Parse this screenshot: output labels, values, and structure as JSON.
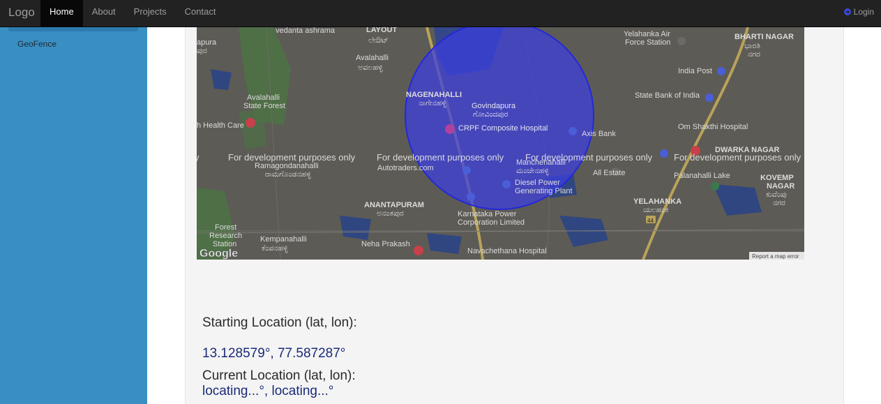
{
  "navbar": {
    "brand": "Logo",
    "items": [
      {
        "label": "Home",
        "active": true
      },
      {
        "label": "About"
      },
      {
        "label": "Projects"
      },
      {
        "label": "Contact"
      }
    ],
    "login_label": "Login"
  },
  "sidebar": {
    "items": [
      {
        "label": "GeoFence"
      }
    ]
  },
  "map": {
    "watermark": "For development purposes only",
    "report_label": "Report a map error",
    "google_logo": "Google",
    "places": [
      {
        "name": "vedanta ashrama"
      },
      {
        "name": "LAYOUT"
      },
      {
        "name": "ಲೇಔಟ್"
      },
      {
        "name": "Avalahalli"
      },
      {
        "name": "ಅವಲಹಳ್ಳಿ"
      },
      {
        "name": "Avalahalli"
      },
      {
        "name": "State Forest"
      },
      {
        "name": "h Health Care"
      },
      {
        "name": "Ramagondanahalli"
      },
      {
        "name": "ರಾಮಗೊಂಡನಹಳ್ಳಿ"
      },
      {
        "name": "Forest"
      },
      {
        "name": "Research"
      },
      {
        "name": "Station"
      },
      {
        "name": "Kempanahalli"
      },
      {
        "name": "ಕೆಂಪನಹಳ್ಳಿ"
      },
      {
        "name": "NAGENAHALLI"
      },
      {
        "name": "ನಾಗೇನಹಳ್ಳಿ"
      },
      {
        "name": "Govindapura"
      },
      {
        "name": "ಗೋವಿಂದಪುರ"
      },
      {
        "name": "CRPF Composite Hospital"
      },
      {
        "name": "Axis Bank"
      },
      {
        "name": "Autotraders.com"
      },
      {
        "name": "Diesel Power"
      },
      {
        "name": "Generating Plant"
      },
      {
        "name": "Manchenahalli"
      },
      {
        "name": "ಮಂಚೇನಹಳ್ಳಿ"
      },
      {
        "name": "ANANTAPURAM"
      },
      {
        "name": "ಅನಂತಪುರ"
      },
      {
        "name": "Karnataka Power"
      },
      {
        "name": "Corporation Limited"
      },
      {
        "name": "Neha Prakash"
      },
      {
        "name": "Navachethana Hospital"
      },
      {
        "name": "Yelahanka Air"
      },
      {
        "name": "Force Station"
      },
      {
        "name": "India Post"
      },
      {
        "name": "State Bank of India"
      },
      {
        "name": "Om Shakthi Hospital"
      },
      {
        "name": "BHARTI NAGAR"
      },
      {
        "name": "ಭಾರತಿ"
      },
      {
        "name": "ನಗರ"
      },
      {
        "name": "DWARKA NAGAR"
      },
      {
        "name": "Palanahalli Lake"
      },
      {
        "name": "KOVEMP"
      },
      {
        "name": "NAGAR"
      },
      {
        "name": "ಕುವೆಂಪು"
      },
      {
        "name": "ನಗರ"
      },
      {
        "name": "YELAHANKA"
      },
      {
        "name": "ಯಲಹಂಕ"
      },
      {
        "name": "44"
      },
      {
        "name": "All Estate"
      },
      {
        "name": "apura"
      },
      {
        "name": "ಪುರ"
      }
    ],
    "colors": {
      "circle": "#3b3fe0",
      "base": "#5d5b55"
    }
  },
  "location": {
    "start_label": "Starting Location (lat, lon):",
    "start_value": "13.128579°, 77.587287°",
    "current_label": "Current Location (lat, lon):",
    "current_value": "locating...°, locating...°"
  },
  "colors": {
    "sidebar": "#3a8fc2",
    "navbar": "#222222",
    "value_text": "#1a2a7a"
  }
}
